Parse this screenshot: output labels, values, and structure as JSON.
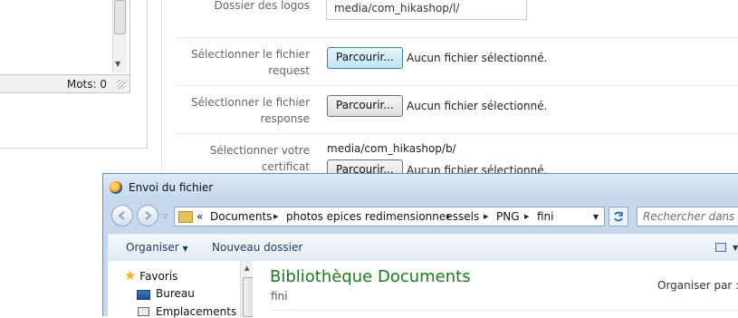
{
  "editor": {
    "word_count": "Mots: 0"
  },
  "form": {
    "logos_label": "Dossier des logos",
    "logos_value": "media/com_hikashop/l/",
    "request_label_1": "Sélectionner le fichier",
    "request_label_2": "request",
    "response_label_1": "Sélectionner le fichier",
    "response_label_2": "response",
    "cert_label_1": "Sélectionner votre",
    "cert_label_2": "certificat",
    "cert_path": "media/com_hikashop/b/",
    "browse_label": "Parcourir...",
    "no_file": "Aucun fichier sélectionné."
  },
  "dialog": {
    "title": "Envoi du fichier",
    "address": {
      "overflow": "«",
      "crumbs": [
        "Documents",
        "photos epices redimensionnees",
        "sels",
        "PNG",
        "fini"
      ]
    },
    "search_placeholder": "Rechercher dans : fini",
    "toolbar": {
      "organize": "Organiser",
      "new_folder": "Nouveau dossier"
    },
    "nav": {
      "favorites": "Favoris",
      "desktop": "Bureau",
      "recent_places": "Emplacements récents"
    },
    "library_title": "Bibliothèque Documents",
    "library_subtitle": "fini",
    "arrange_by": "Organiser par :"
  },
  "colors": {
    "library_title": "#1e7a1e",
    "active_button": "#bfe4f7",
    "dialog_frame": "#c5d8ec"
  }
}
